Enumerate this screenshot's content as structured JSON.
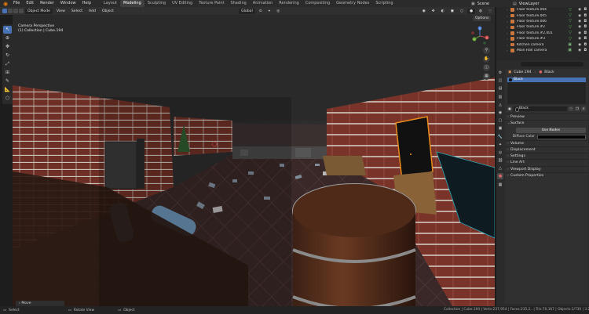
{
  "topbar": {
    "menus": [
      "File",
      "Edit",
      "Render",
      "Window",
      "Help"
    ],
    "workspaces": [
      "Layout",
      "Modeling",
      "Sculpting",
      "UV Editing",
      "Texture Paint",
      "Shading",
      "Animation",
      "Rendering",
      "Compositing",
      "Geometry Nodes",
      "Scripting"
    ],
    "active_workspace": "Modeling",
    "scene_label": "Scene",
    "view_layer_label": "ViewLayer"
  },
  "viewport_header": {
    "mode": "Object Mode",
    "menus": [
      "View",
      "Select",
      "Add",
      "Object"
    ],
    "transform_orientation": "Global",
    "options_label": "Options"
  },
  "viewport": {
    "view_name": "Camera Perspective",
    "collection_info": "(1) Collection | Cube.194",
    "last_op_panel": "Move",
    "gizmo": {
      "x": "X",
      "y": "Y",
      "z": "Z"
    }
  },
  "toolbar": {
    "tools": [
      "select-icon",
      "cursor-icon",
      "move-icon",
      "rotate-icon",
      "scale-icon",
      "transform-icon",
      "annotate-icon",
      "measure-icon",
      "add-cube-icon"
    ]
  },
  "outliner": {
    "items": [
      {
        "name": "Floor texture.004"
      },
      {
        "name": "Floor texture.005"
      },
      {
        "name": "Floor texture.006"
      },
      {
        "name": "Floor texture.#2"
      },
      {
        "name": "Floor texture.#2.001"
      },
      {
        "name": "Floor texture.#3"
      },
      {
        "name": "Kitchen camera"
      },
      {
        "name": "Main Hall camera"
      }
    ]
  },
  "properties": {
    "breadcrumb_object": "Cube.194",
    "breadcrumb_material": "Black",
    "material_slot": "Black",
    "material_name": "Black",
    "panels": {
      "preview": "Preview",
      "surface": "Surface",
      "use_nodes": "Use Nodes",
      "diffuse_color_label": "Diffuse Color",
      "volume": "Volume",
      "displacement": "Displacement",
      "settings": "Settings",
      "line_art": "Line Art",
      "viewport_display": "Viewport Display",
      "custom_properties": "Custom Properties"
    },
    "diffuse_color": "#050505"
  },
  "statusbar": {
    "select": "Select",
    "rotate_view": "Rotate View",
    "object": "Object",
    "stats": "Collection | Cube.194 | Verts:237,954 | Faces:235,2.. | Tris:70,167 | Objects:1/730 | 3.2.1"
  },
  "colors": {
    "accent": "#4772b3",
    "selection_outline": "#e88a1a",
    "brick": "#8a3b2d"
  }
}
